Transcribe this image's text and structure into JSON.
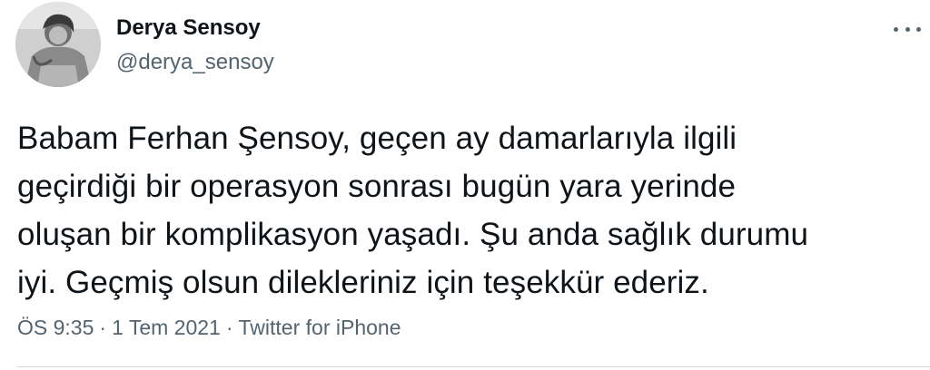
{
  "author": {
    "display_name": "Derya Sensoy",
    "handle": "@derya_sensoy",
    "avatar_icon": "profile-photo"
  },
  "menu": {
    "icon": "more-options-icon"
  },
  "tweet": {
    "lines": [
      "Babam Ferhan Şensoy, geçen ay damarlarıyla ilgili",
      "geçirdiği bir operasyon sonrası bugün yara yerinde",
      "oluşan bir komplikasyon yaşadı. Şu anda sağlık durumu",
      "iyi. Geçmiş olsun dilekleriniz için teşekkür ederiz."
    ]
  },
  "meta": {
    "time": "ÖS 9:35",
    "separator": "·",
    "date": "1 Tem 2021",
    "source": "Twitter for iPhone"
  },
  "colors": {
    "text_primary": "#0f1419",
    "text_secondary": "#536471",
    "divider": "#cfd9de"
  }
}
